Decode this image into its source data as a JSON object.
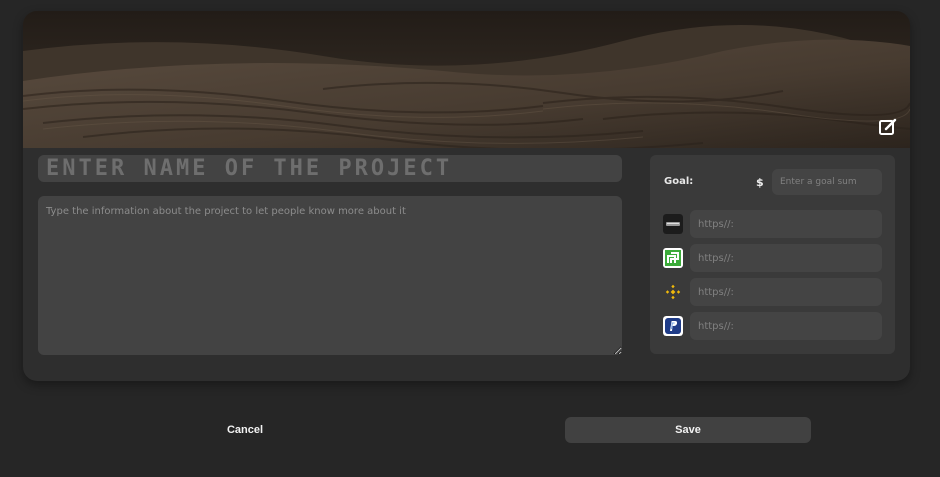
{
  "banner": {
    "image": "desert-dunes",
    "edit_icon": "edit-icon"
  },
  "project": {
    "name_placeholder": "ENTER NAME OF THE PROJECT",
    "description_placeholder": "Type the information about the project to let people know more about it"
  },
  "goal": {
    "label": "Goal:",
    "currency": "$",
    "placeholder": "Enter a goal sum"
  },
  "links": [
    {
      "icon": "monobank-icon",
      "placeholder": "https//:"
    },
    {
      "icon": "privatbank-icon",
      "placeholder": "https//:"
    },
    {
      "icon": "binance-icon",
      "placeholder": "https//:"
    },
    {
      "icon": "paypal-icon",
      "placeholder": "https//:"
    }
  ],
  "actions": {
    "cancel_label": "Cancel",
    "save_label": "Save"
  }
}
